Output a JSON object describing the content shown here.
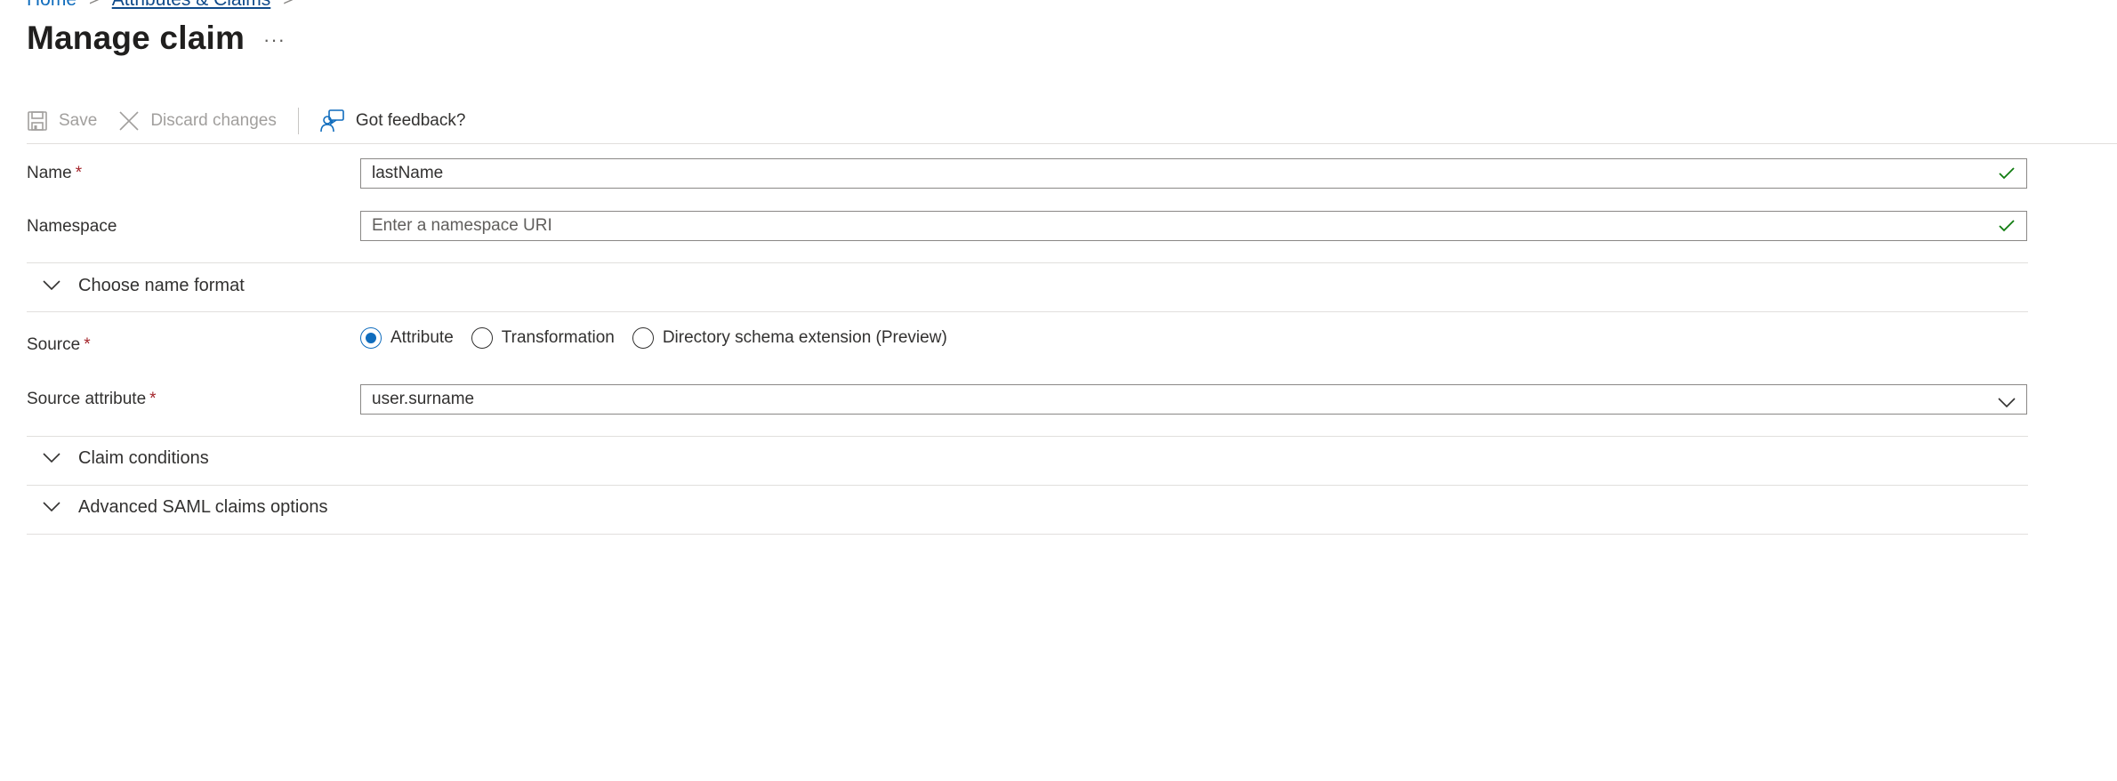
{
  "breadcrumb": {
    "home": "Home",
    "attributes": "Attributes & Claims",
    "separator": ">"
  },
  "page": {
    "title": "Manage claim",
    "more": "···"
  },
  "toolbar": {
    "save_label": "Save",
    "discard_label": "Discard changes",
    "feedback_label": "Got feedback?"
  },
  "form": {
    "name": {
      "label": "Name",
      "required_mark": "*",
      "value": "lastName"
    },
    "namespace": {
      "label": "Namespace",
      "placeholder": "Enter a namespace URI"
    },
    "name_format": {
      "label": "Choose name format"
    },
    "source": {
      "label": "Source",
      "required_mark": "*",
      "options": [
        "Attribute",
        "Transformation",
        "Directory schema extension (Preview)"
      ],
      "selected": "Attribute"
    },
    "source_attribute": {
      "label": "Source attribute",
      "required_mark": "*",
      "value": "user.surname"
    }
  },
  "sections": {
    "claim_conditions": "Claim conditions",
    "advanced_saml": "Advanced SAML claims options"
  },
  "colors": {
    "accent": "#0f6cbd",
    "required": "#a4262c",
    "valid_check": "#107c10",
    "disabled_text": "#a19f9d",
    "border": "#8a8886"
  },
  "icons": {
    "save": "save-icon",
    "discard": "close-icon",
    "feedback": "feedback-icon",
    "valid": "checkmark-icon",
    "expand": "chevron-down-icon"
  }
}
